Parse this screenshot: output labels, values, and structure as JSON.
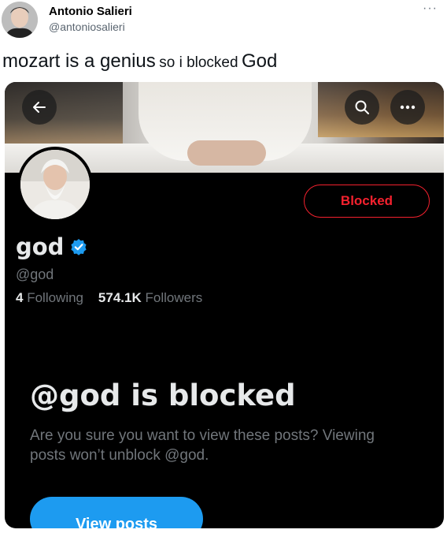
{
  "tweet": {
    "author_name": "Antonio Salieri",
    "author_handle": "@antoniosalieri",
    "more_icon": "more-horizontal-icon",
    "text_part1": "mozart is a genius",
    "text_part2": "so i blocked",
    "text_part3": "God"
  },
  "profile": {
    "back_icon": "arrow-left-icon",
    "search_icon": "search-icon",
    "more_icon": "more-horizontal-icon",
    "blocked_button": "Blocked",
    "display_name": "god",
    "verified_icon": "verified-badge-icon",
    "handle": "@god",
    "following_count": "4",
    "following_label": "Following",
    "followers_count": "574.1K",
    "followers_label": "Followers",
    "blocked_title": "@god is blocked",
    "blocked_desc": "Are you sure you want to view these posts? Viewing posts won’t unblock @god.",
    "view_posts_button": "View posts"
  },
  "colors": {
    "danger": "#f4212e",
    "accent": "#1d9bf0",
    "muted": "#71767b",
    "dark_bg": "#000000"
  }
}
